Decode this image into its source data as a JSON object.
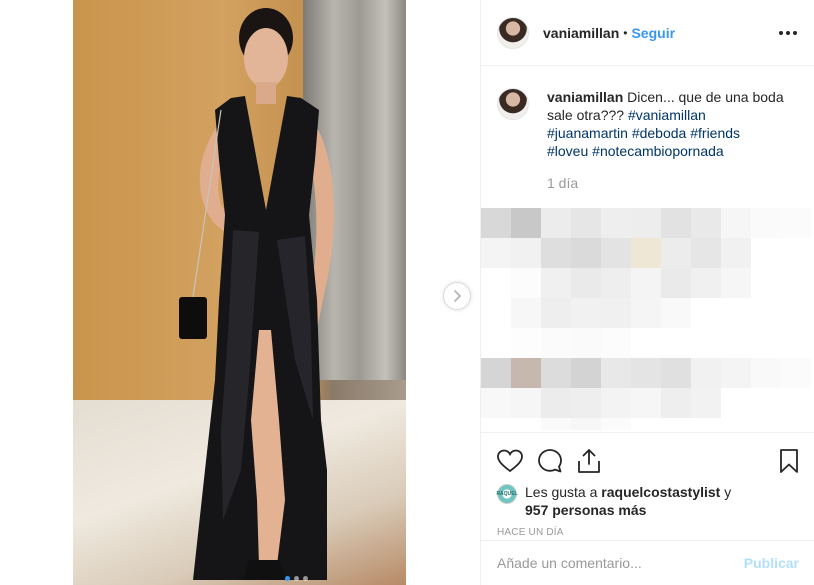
{
  "post": {
    "username": "vaniamillan",
    "separator": "•",
    "follow_label": "Seguir",
    "more_icon": "more-horizontal-icon"
  },
  "caption": {
    "username": "vaniamillan",
    "text": "Dicen... que de una boda sale otra???",
    "hashtags_line1": "#vaniamillan",
    "hashtags_line2": [
      "#juanamartin",
      "#deboda",
      "#friends"
    ],
    "hashtags_line3": [
      "#loveu",
      "#notecambioporn​ada"
    ],
    "time": "1 día"
  },
  "carousel": {
    "slide_count": 3,
    "active_slide": 1,
    "next_icon": "chevron-right-icon"
  },
  "actions": {
    "like_icon": "heart-icon",
    "comment_icon": "comment-icon",
    "share_icon": "share-icon",
    "save_icon": "bookmark-icon"
  },
  "likes": {
    "prefix": "Les gusta a",
    "user": "raquelcostastylist",
    "conj": "y",
    "others": "957 personas más",
    "avatar_text": "RAQUEL"
  },
  "posted": "HACE UN DÍA",
  "comment_box": {
    "placeholder": "Añade un comentario...",
    "publish_label": "Publicar"
  },
  "colors": {
    "accent": "#3897f0",
    "hashtag": "#003569",
    "publish_disabled": "#b2dffc"
  }
}
